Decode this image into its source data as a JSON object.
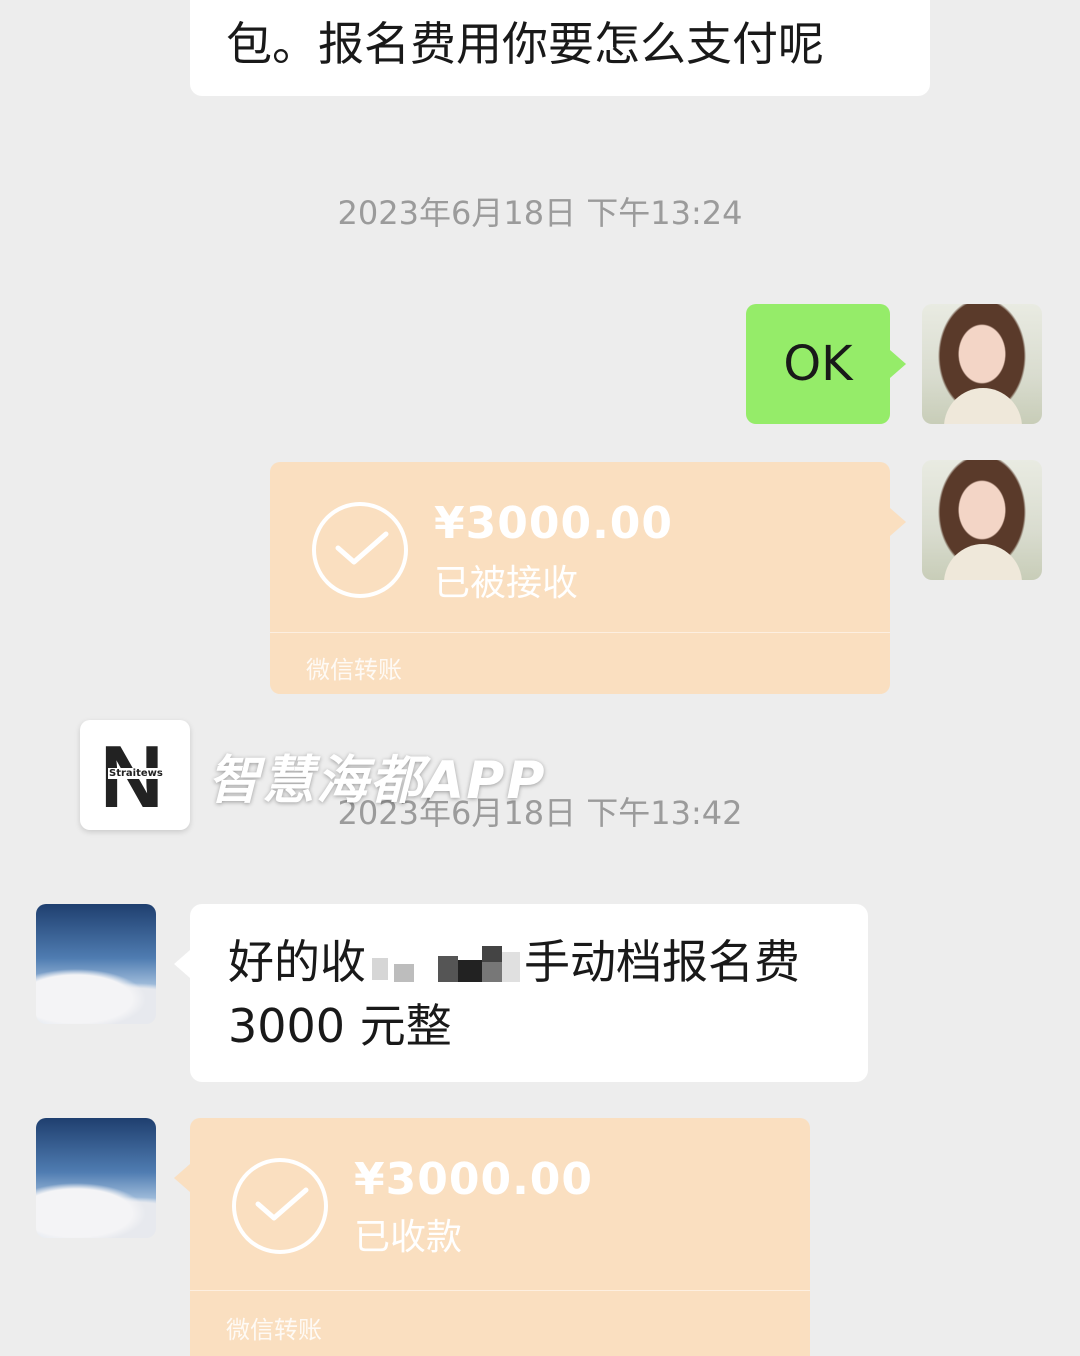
{
  "messages": {
    "top_partial": "包。报名费用你要怎么支付呢",
    "timestamp_1": "2023年6月18日 下午13:24",
    "ok_text": "OK",
    "transfer_sent": {
      "amount": "¥3000.00",
      "status": "已被接收",
      "footer": "微信转账"
    },
    "timestamp_2": "2023年6月18日 下午13:42",
    "reply_line1_a": "好的收",
    "reply_line1_b": "手动档报名费",
    "reply_line2": "3000 元整",
    "transfer_received": {
      "amount": "¥3000.00",
      "status": "已收款",
      "footer": "微信转账"
    }
  },
  "watermark": {
    "logo_letter": "N",
    "logo_sub": "Straitews",
    "text": "智慧海都APP"
  },
  "colors": {
    "background": "#ededed",
    "green_bubble": "#95ec69",
    "transfer_card": "#fadfc0",
    "timestamp": "#9b9b9b"
  }
}
